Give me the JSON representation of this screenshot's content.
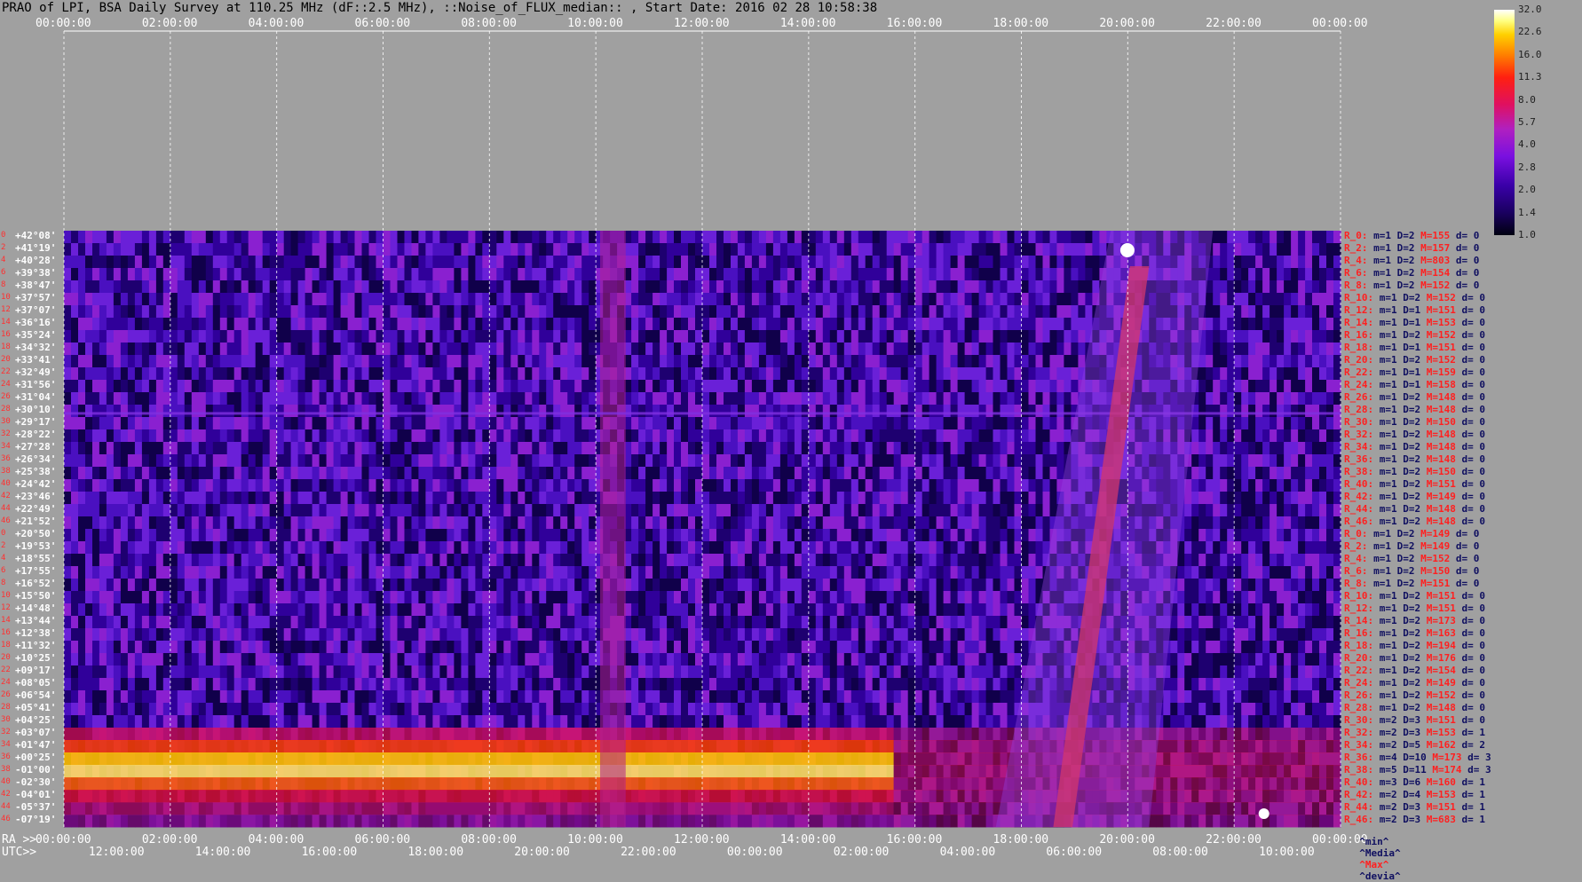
{
  "title": "PRAO of LPI, BSA Daily Survey at 110.25 MHz (dF::2.5 MHz), ::Noise_of_FLUX_median:: , Start Date: 2016 02 28 10:58:38",
  "chart_data": {
    "type": "heatmap",
    "title": "PRAO of LPI, BSA Daily Survey at 110.25 MHz (dF::2.5 MHz), ::Noise_of_FLUX_median:: , Start Date: 2016 02 28 10:58:38",
    "top_time_ticks": [
      "00:00:00",
      "02:00:00",
      "04:00:00",
      "06:00:00",
      "08:00:00",
      "10:00:00",
      "12:00:00",
      "14:00:00",
      "16:00:00",
      "18:00:00",
      "20:00:00",
      "22:00:00",
      "00:00:00"
    ],
    "ra_ticks": [
      "00:00:00",
      "02:00:00",
      "04:00:00",
      "06:00:00",
      "08:00:00",
      "10:00:00",
      "12:00:00",
      "14:00:00",
      "16:00:00",
      "18:00:00",
      "20:00:00",
      "22:00:00",
      "00:00:00"
    ],
    "utc_ticks": [
      "12:00:00",
      "14:00:00",
      "16:00:00",
      "18:00:00",
      "20:00:00",
      "22:00:00",
      "00:00:00",
      "02:00:00",
      "04:00:00",
      "06:00:00",
      "08:00:00",
      "10:00:00"
    ],
    "ra_prefix": "RA >>",
    "utc_prefix": "UTC>>",
    "colorbar_ticks": [
      "32.0",
      "22.6",
      "16.0",
      "11.3",
      "8.0",
      "5.7",
      "4.0",
      "2.8",
      "2.0",
      "1.4",
      "1.0"
    ],
    "declinations": [
      "+42°08'",
      "+41°19'",
      "+40°28'",
      "+39°38'",
      "+38°47'",
      "+37°57'",
      "+37°07'",
      "+36°16'",
      "+35°24'",
      "+34°32'",
      "+33°41'",
      "+32°49'",
      "+31°56'",
      "+31°04'",
      "+30°10'",
      "+29°17'",
      "+28°22'",
      "+27°28'",
      "+26°34'",
      "+25°38'",
      "+24°42'",
      "+23°46'",
      "+22°49'",
      "+21°52'",
      "+20°50'",
      "+19°53'",
      "+18°55'",
      "+17°55'",
      "+16°52'",
      "+15°50'",
      "+14°48'",
      "+13°44'",
      "+12°38'",
      "+11°32'",
      "+10°25'",
      "+09°17'",
      "+08°05'",
      "+06°54'",
      "+05°41'",
      "+04°25'",
      "+03°07'",
      "+01°47'",
      "+00°25'",
      "-01°00'",
      "-02°30'",
      "-04°01'",
      "-05°37'",
      "-07°19'"
    ],
    "row_indices": [
      "0",
      "2",
      "4",
      "6",
      "8",
      "10",
      "12",
      "14",
      "16",
      "18",
      "20",
      "22",
      "24",
      "26",
      "28",
      "30",
      "32",
      "34",
      "36",
      "38",
      "40",
      "42",
      "44",
      "46",
      "0",
      "2",
      "4",
      "6",
      "8",
      "10",
      "12",
      "14",
      "16",
      "18",
      "20",
      "22",
      "24",
      "26",
      "28",
      "30",
      "32",
      "34",
      "36",
      "38",
      "40",
      "42",
      "44",
      "46"
    ],
    "right_rows": [
      {
        "name": "R_0:",
        "stats": "m=1 D=2",
        "max": "M=155",
        "d": "d= 0"
      },
      {
        "name": "R_2:",
        "stats": "m=1 D=2",
        "max": "M=157",
        "d": "d= 0"
      },
      {
        "name": "R_4:",
        "stats": "m=1 D=2",
        "max": "M=803",
        "d": "d= 0"
      },
      {
        "name": "R_6:",
        "stats": "m=1 D=2",
        "max": "M=154",
        "d": "d= 0"
      },
      {
        "name": "R_8:",
        "stats": "m=1 D=2",
        "max": "M=152",
        "d": "d= 0"
      },
      {
        "name": "R_10:",
        "stats": "m=1 D=2",
        "max": "M=152",
        "d": "d= 0"
      },
      {
        "name": "R_12:",
        "stats": "m=1 D=1",
        "max": "M=151",
        "d": "d= 0"
      },
      {
        "name": "R_14:",
        "stats": "m=1 D=1",
        "max": "M=153",
        "d": "d= 0"
      },
      {
        "name": "R_16:",
        "stats": "m=1 D=2",
        "max": "M=152",
        "d": "d= 0"
      },
      {
        "name": "R_18:",
        "stats": "m=1 D=1",
        "max": "M=151",
        "d": "d= 0"
      },
      {
        "name": "R_20:",
        "stats": "m=1 D=2",
        "max": "M=152",
        "d": "d= 0"
      },
      {
        "name": "R_22:",
        "stats": "m=1 D=1",
        "max": "M=159",
        "d": "d= 0"
      },
      {
        "name": "R_24:",
        "stats": "m=1 D=1",
        "max": "M=158",
        "d": "d= 0"
      },
      {
        "name": "R_26:",
        "stats": "m=1 D=2",
        "max": "M=148",
        "d": "d= 0"
      },
      {
        "name": "R_28:",
        "stats": "m=1 D=2",
        "max": "M=148",
        "d": "d= 0"
      },
      {
        "name": "R_30:",
        "stats": "m=1 D=2",
        "max": "M=150",
        "d": "d= 0"
      },
      {
        "name": "R_32:",
        "stats": "m=1 D=2",
        "max": "M=148",
        "d": "d= 0"
      },
      {
        "name": "R_34:",
        "stats": "m=1 D=2",
        "max": "M=148",
        "d": "d= 0"
      },
      {
        "name": "R_36:",
        "stats": "m=1 D=2",
        "max": "M=148",
        "d": "d= 0"
      },
      {
        "name": "R_38:",
        "stats": "m=1 D=2",
        "max": "M=150",
        "d": "d= 0"
      },
      {
        "name": "R_40:",
        "stats": "m=1 D=2",
        "max": "M=151",
        "d": "d= 0"
      },
      {
        "name": "R_42:",
        "stats": "m=1 D=2",
        "max": "M=149",
        "d": "d= 0"
      },
      {
        "name": "R_44:",
        "stats": "m=1 D=2",
        "max": "M=148",
        "d": "d= 0"
      },
      {
        "name": "R_46:",
        "stats": "m=1 D=2",
        "max": "M=148",
        "d": "d= 0"
      },
      {
        "name": "R_0:",
        "stats": "m=1 D=2",
        "max": "M=149",
        "d": "d= 0"
      },
      {
        "name": "R_2:",
        "stats": "m=1 D=2",
        "max": "M=149",
        "d": "d= 0"
      },
      {
        "name": "R_4:",
        "stats": "m=1 D=2",
        "max": "M=152",
        "d": "d= 0"
      },
      {
        "name": "R_6:",
        "stats": "m=1 D=2",
        "max": "M=150",
        "d": "d= 0"
      },
      {
        "name": "R_8:",
        "stats": "m=1 D=2",
        "max": "M=151",
        "d": "d= 0"
      },
      {
        "name": "R_10:",
        "stats": "m=1 D=2",
        "max": "M=151",
        "d": "d= 0"
      },
      {
        "name": "R_12:",
        "stats": "m=1 D=2",
        "max": "M=151",
        "d": "d= 0"
      },
      {
        "name": "R_14:",
        "stats": "m=1 D=2",
        "max": "M=173",
        "d": "d= 0"
      },
      {
        "name": "R_16:",
        "stats": "m=1 D=2",
        "max": "M=163",
        "d": "d= 0"
      },
      {
        "name": "R_18:",
        "stats": "m=1 D=2",
        "max": "M=194",
        "d": "d= 0"
      },
      {
        "name": "R_20:",
        "stats": "m=1 D=2",
        "max": "M=176",
        "d": "d= 0"
      },
      {
        "name": "R_22:",
        "stats": "m=1 D=2",
        "max": "M=154",
        "d": "d= 0"
      },
      {
        "name": "R_24:",
        "stats": "m=1 D=2",
        "max": "M=149",
        "d": "d= 0"
      },
      {
        "name": "R_26:",
        "stats": "m=1 D=2",
        "max": "M=152",
        "d": "d= 0"
      },
      {
        "name": "R_28:",
        "stats": "m=1 D=2",
        "max": "M=148",
        "d": "d= 0"
      },
      {
        "name": "R_30:",
        "stats": "m=2 D=3",
        "max": "M=151",
        "d": "d= 0"
      },
      {
        "name": "R_32:",
        "stats": "m=2 D=3",
        "max": "M=153",
        "d": "d= 1"
      },
      {
        "name": "R_34:",
        "stats": "m=2 D=5",
        "max": "M=162",
        "d": "d= 2"
      },
      {
        "name": "R_36:",
        "stats": "m=4 D=10",
        "max": "M=173",
        "d": "d= 3"
      },
      {
        "name": "R_38:",
        "stats": "m=5 D=11",
        "max": "M=174",
        "d": "d= 3"
      },
      {
        "name": "R_40:",
        "stats": "m=3 D=6",
        "max": "M=160",
        "d": "d= 1"
      },
      {
        "name": "R_42:",
        "stats": "m=2 D=4",
        "max": "M=153",
        "d": "d= 1"
      },
      {
        "name": "R_44:",
        "stats": "m=2 D=3",
        "max": "M=151",
        "d": "d= 1"
      },
      {
        "name": "R_46:",
        "stats": "m=2 D=3",
        "max": "M=683",
        "d": "d= 1"
      }
    ],
    "stat_legend": {
      "min": "^min^",
      "median": "^Media^",
      "max": "^Max^",
      "dev": "^devia^"
    },
    "colors": {
      "background": "#a0a0a0",
      "text_white": "#ffffff",
      "row_red": "#ff2020",
      "row_blue": "#101060"
    }
  }
}
